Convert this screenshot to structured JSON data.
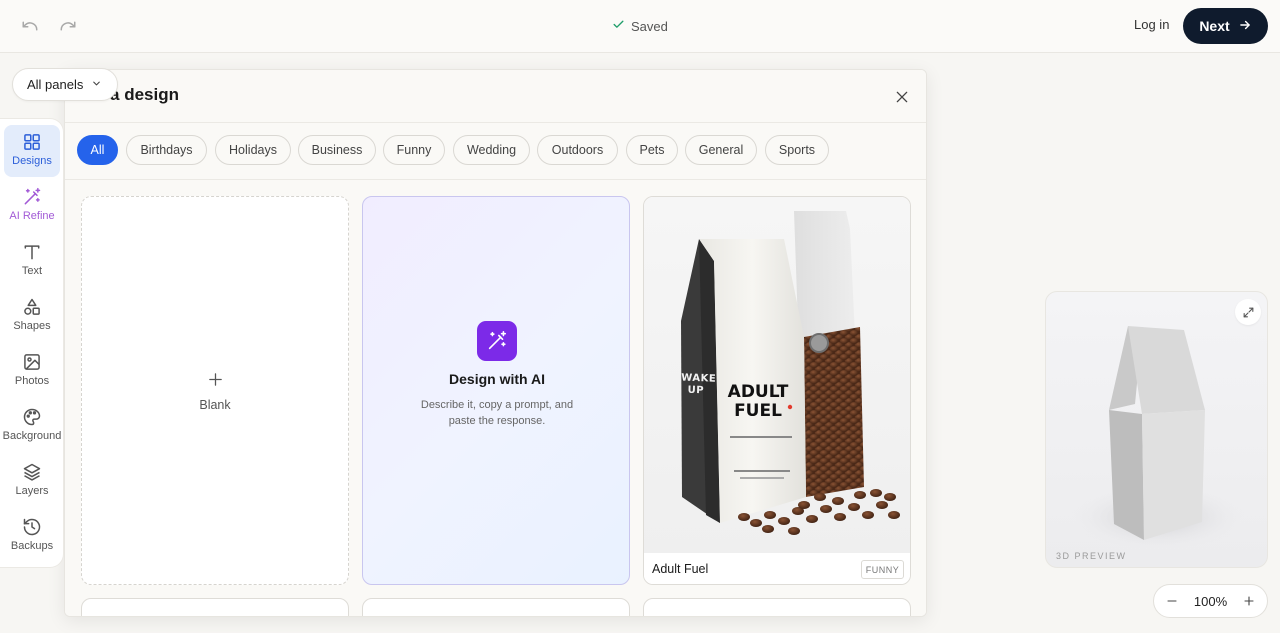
{
  "topbar": {
    "undo_icon": "undo-icon",
    "redo_icon": "redo-icon",
    "saved_label": "Saved",
    "login_label": "Log in",
    "next_label": "Next"
  },
  "panels_dropdown": {
    "label": "All panels"
  },
  "toolbar": {
    "items": [
      {
        "label": "Designs",
        "icon": "grid-icon",
        "active": true
      },
      {
        "label": "AI Refine",
        "icon": "magic-wand-icon"
      },
      {
        "label": "Text",
        "icon": "text-icon"
      },
      {
        "label": "Shapes",
        "icon": "shapes-icon"
      },
      {
        "label": "Photos",
        "icon": "image-icon"
      },
      {
        "label": "Background",
        "icon": "palette-icon"
      },
      {
        "label": "Layers",
        "icon": "layers-icon"
      },
      {
        "label": "Backups",
        "icon": "history-icon"
      }
    ]
  },
  "dialog": {
    "title": "ose a design",
    "categories": [
      "All",
      "Birthdays",
      "Holidays",
      "Business",
      "Funny",
      "Wedding",
      "Outdoors",
      "Pets",
      "General",
      "Sports"
    ],
    "active_category": "All",
    "blank_card": {
      "label": "Blank"
    },
    "ai_card": {
      "title": "Design with AI",
      "description": "Describe it, copy a prompt, and paste the response."
    },
    "product_card": {
      "name": "Adult Fuel",
      "tag": "FUNNY",
      "package_side_text": "WAKE UP",
      "package_front_title": "ADULT FUEL"
    }
  },
  "preview": {
    "label": "3D PREVIEW"
  },
  "zoom": {
    "value": "100%"
  },
  "colors": {
    "accent": "#2563eb",
    "primary_dark": "#0f1b2d",
    "ai_purple": "#7c2ae8",
    "active_tool_bg": "#e3ecfb"
  }
}
